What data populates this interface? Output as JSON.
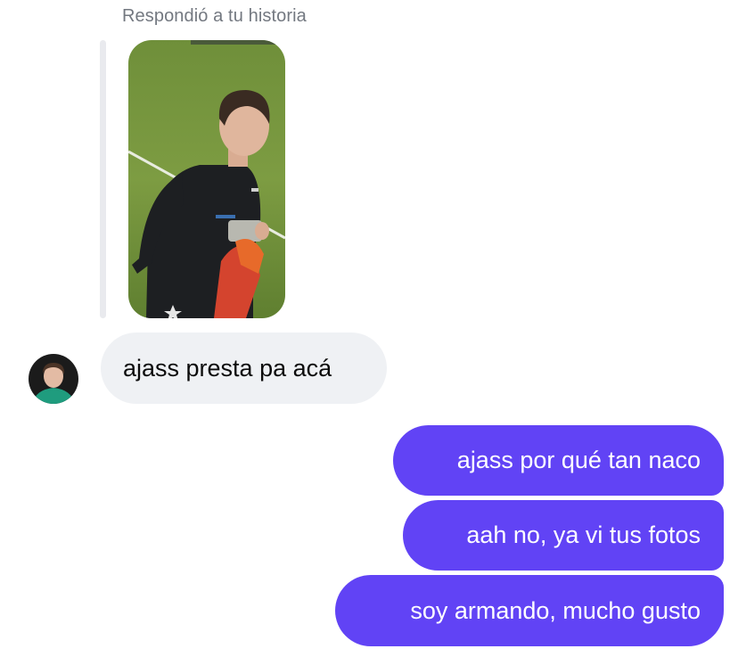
{
  "story_reply": {
    "label": "Respondió a tu historia"
  },
  "messages": [
    {
      "direction": "received",
      "text": "ajass presta pa acá"
    },
    {
      "direction": "sent",
      "text": "ajass por qué tan naco"
    },
    {
      "direction": "sent",
      "text": "aah no, ya vi tus fotos"
    },
    {
      "direction": "sent",
      "text": "soy armando, mucho gusto"
    }
  ],
  "colors": {
    "sent_bubble": "#6143f5",
    "received_bubble": "#eff1f4",
    "label_text": "#737880"
  }
}
